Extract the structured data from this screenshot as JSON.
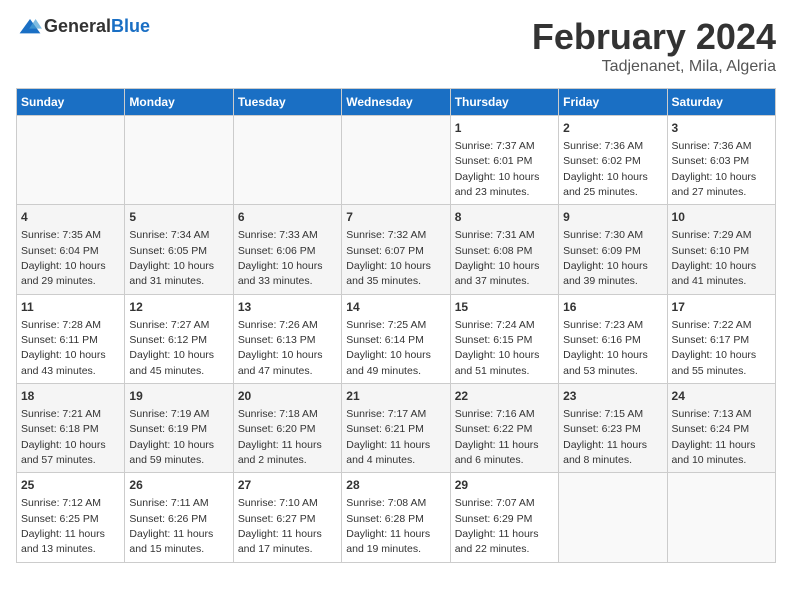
{
  "logo": {
    "general": "General",
    "blue": "Blue"
  },
  "title": "February 2024",
  "subtitle": "Tadjenanet, Mila, Algeria",
  "weekdays": [
    "Sunday",
    "Monday",
    "Tuesday",
    "Wednesday",
    "Thursday",
    "Friday",
    "Saturday"
  ],
  "weeks": [
    [
      {
        "day": "",
        "info": ""
      },
      {
        "day": "",
        "info": ""
      },
      {
        "day": "",
        "info": ""
      },
      {
        "day": "",
        "info": ""
      },
      {
        "day": "1",
        "info": "Sunrise: 7:37 AM\nSunset: 6:01 PM\nDaylight: 10 hours\nand 23 minutes."
      },
      {
        "day": "2",
        "info": "Sunrise: 7:36 AM\nSunset: 6:02 PM\nDaylight: 10 hours\nand 25 minutes."
      },
      {
        "day": "3",
        "info": "Sunrise: 7:36 AM\nSunset: 6:03 PM\nDaylight: 10 hours\nand 27 minutes."
      }
    ],
    [
      {
        "day": "4",
        "info": "Sunrise: 7:35 AM\nSunset: 6:04 PM\nDaylight: 10 hours\nand 29 minutes."
      },
      {
        "day": "5",
        "info": "Sunrise: 7:34 AM\nSunset: 6:05 PM\nDaylight: 10 hours\nand 31 minutes."
      },
      {
        "day": "6",
        "info": "Sunrise: 7:33 AM\nSunset: 6:06 PM\nDaylight: 10 hours\nand 33 minutes."
      },
      {
        "day": "7",
        "info": "Sunrise: 7:32 AM\nSunset: 6:07 PM\nDaylight: 10 hours\nand 35 minutes."
      },
      {
        "day": "8",
        "info": "Sunrise: 7:31 AM\nSunset: 6:08 PM\nDaylight: 10 hours\nand 37 minutes."
      },
      {
        "day": "9",
        "info": "Sunrise: 7:30 AM\nSunset: 6:09 PM\nDaylight: 10 hours\nand 39 minutes."
      },
      {
        "day": "10",
        "info": "Sunrise: 7:29 AM\nSunset: 6:10 PM\nDaylight: 10 hours\nand 41 minutes."
      }
    ],
    [
      {
        "day": "11",
        "info": "Sunrise: 7:28 AM\nSunset: 6:11 PM\nDaylight: 10 hours\nand 43 minutes."
      },
      {
        "day": "12",
        "info": "Sunrise: 7:27 AM\nSunset: 6:12 PM\nDaylight: 10 hours\nand 45 minutes."
      },
      {
        "day": "13",
        "info": "Sunrise: 7:26 AM\nSunset: 6:13 PM\nDaylight: 10 hours\nand 47 minutes."
      },
      {
        "day": "14",
        "info": "Sunrise: 7:25 AM\nSunset: 6:14 PM\nDaylight: 10 hours\nand 49 minutes."
      },
      {
        "day": "15",
        "info": "Sunrise: 7:24 AM\nSunset: 6:15 PM\nDaylight: 10 hours\nand 51 minutes."
      },
      {
        "day": "16",
        "info": "Sunrise: 7:23 AM\nSunset: 6:16 PM\nDaylight: 10 hours\nand 53 minutes."
      },
      {
        "day": "17",
        "info": "Sunrise: 7:22 AM\nSunset: 6:17 PM\nDaylight: 10 hours\nand 55 minutes."
      }
    ],
    [
      {
        "day": "18",
        "info": "Sunrise: 7:21 AM\nSunset: 6:18 PM\nDaylight: 10 hours\nand 57 minutes."
      },
      {
        "day": "19",
        "info": "Sunrise: 7:19 AM\nSunset: 6:19 PM\nDaylight: 10 hours\nand 59 minutes."
      },
      {
        "day": "20",
        "info": "Sunrise: 7:18 AM\nSunset: 6:20 PM\nDaylight: 11 hours\nand 2 minutes."
      },
      {
        "day": "21",
        "info": "Sunrise: 7:17 AM\nSunset: 6:21 PM\nDaylight: 11 hours\nand 4 minutes."
      },
      {
        "day": "22",
        "info": "Sunrise: 7:16 AM\nSunset: 6:22 PM\nDaylight: 11 hours\nand 6 minutes."
      },
      {
        "day": "23",
        "info": "Sunrise: 7:15 AM\nSunset: 6:23 PM\nDaylight: 11 hours\nand 8 minutes."
      },
      {
        "day": "24",
        "info": "Sunrise: 7:13 AM\nSunset: 6:24 PM\nDaylight: 11 hours\nand 10 minutes."
      }
    ],
    [
      {
        "day": "25",
        "info": "Sunrise: 7:12 AM\nSunset: 6:25 PM\nDaylight: 11 hours\nand 13 minutes."
      },
      {
        "day": "26",
        "info": "Sunrise: 7:11 AM\nSunset: 6:26 PM\nDaylight: 11 hours\nand 15 minutes."
      },
      {
        "day": "27",
        "info": "Sunrise: 7:10 AM\nSunset: 6:27 PM\nDaylight: 11 hours\nand 17 minutes."
      },
      {
        "day": "28",
        "info": "Sunrise: 7:08 AM\nSunset: 6:28 PM\nDaylight: 11 hours\nand 19 minutes."
      },
      {
        "day": "29",
        "info": "Sunrise: 7:07 AM\nSunset: 6:29 PM\nDaylight: 11 hours\nand 22 minutes."
      },
      {
        "day": "",
        "info": ""
      },
      {
        "day": "",
        "info": ""
      }
    ]
  ]
}
